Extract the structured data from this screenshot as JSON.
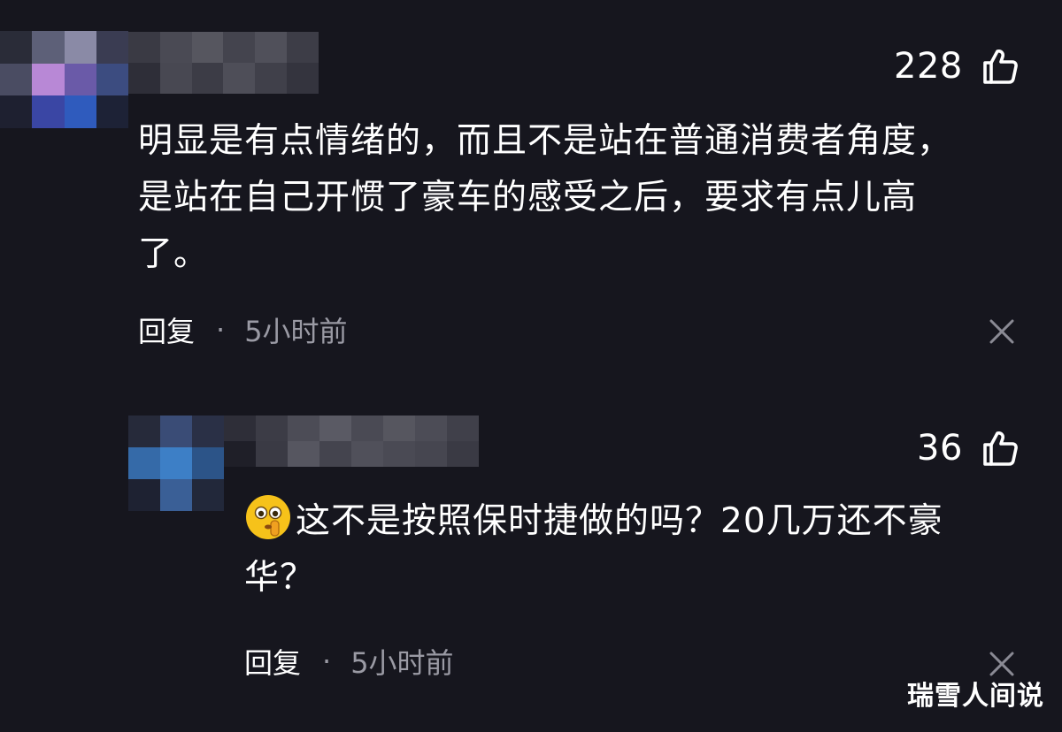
{
  "comments": [
    {
      "likes": "228",
      "text_lines": [
        "明显是有点情绪的，而且不是站在普通消费者角度，",
        "是站在自己开惯了豪车的感受之后，要求有点儿高",
        "了。"
      ],
      "reply_label": "回复",
      "separator": "·",
      "time": "5小时前"
    },
    {
      "likes": "36",
      "text_lines": [
        "这不是按照保时捷做的吗？20几万还不豪",
        "华？"
      ],
      "reply_label": "回复",
      "separator": "·",
      "time": "5小时前",
      "emoji": "shushing-face-emoji"
    }
  ],
  "watermark": "瑞雪人间说",
  "icons": {
    "like": "thumbs-up-icon",
    "close": "close-icon"
  },
  "colors": {
    "background": "#16161e",
    "text": "#ffffff",
    "meta": "#9a9aa4"
  }
}
